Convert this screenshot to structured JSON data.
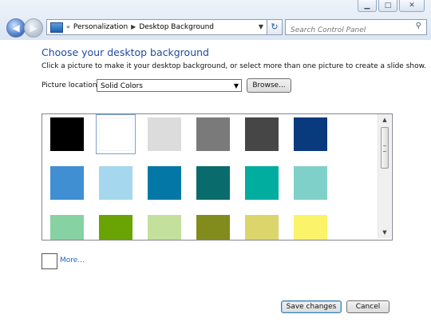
{
  "window": {
    "minimize_glyph": "▁",
    "maximize_glyph": "□",
    "close_glyph": "✕"
  },
  "nav": {
    "back_glyph": "◀",
    "forward_glyph": "▶"
  },
  "address": {
    "overflow": "«",
    "crumb1": "Personalization",
    "sep": "▶",
    "crumb2": "Desktop Background",
    "dropdown": "▼"
  },
  "refresh_glyph": "↻",
  "search": {
    "placeholder": "Search Control Panel",
    "icon": "⚲"
  },
  "page": {
    "title": "Choose your desktop background",
    "description": "Click a picture to make it your desktop background, or select more than one picture to create a slide show."
  },
  "location": {
    "label": "Picture location:",
    "value": "Solid Colors",
    "arrow": "▼",
    "browse": "Browse..."
  },
  "colors": [
    [
      "#000000",
      "#ffffff",
      "#dcdcdc",
      "#7a7a7a",
      "#464646",
      "#0a3a7e"
    ],
    [
      "#3f8fd2",
      "#a5d8ee",
      "#0378a6",
      "#0a6b6c",
      "#00ad9f",
      "#7fd0c8"
    ],
    [
      "#86d2a3",
      "#6aa404",
      "#c3e19c",
      "#828c1c",
      "#dcd56c",
      "#fbf46a"
    ]
  ],
  "selected": [
    0,
    1
  ],
  "scroll": {
    "up": "▲",
    "down": "▼"
  },
  "more": {
    "label": "More..."
  },
  "footer": {
    "save": "Save changes",
    "cancel": "Cancel"
  }
}
